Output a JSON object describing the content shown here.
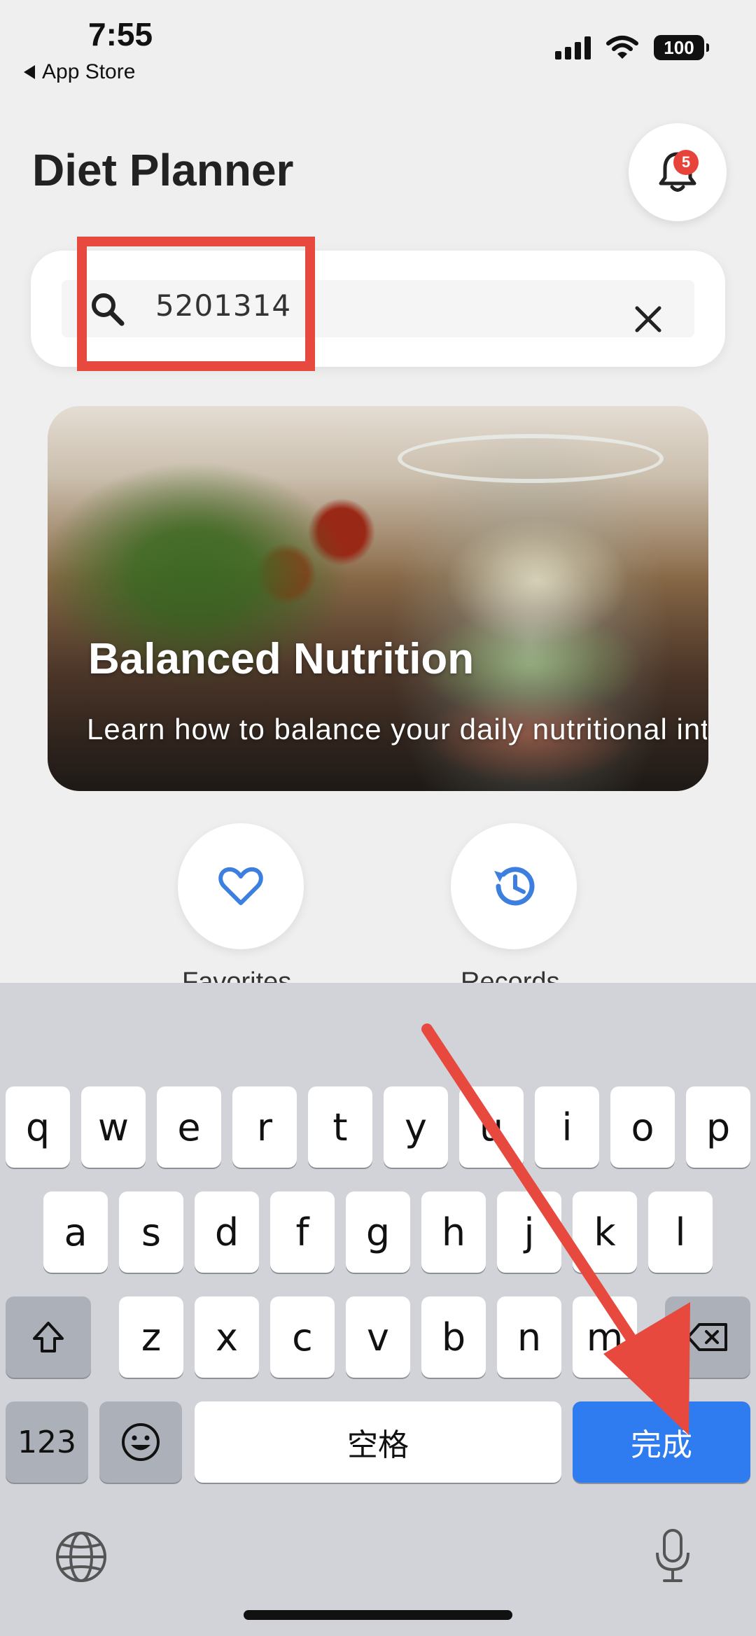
{
  "status_bar": {
    "time": "7:55",
    "back_app": "App Store",
    "battery": "100"
  },
  "header": {
    "title": "Diet Planner",
    "notification_count": "5"
  },
  "search": {
    "value": "5201314",
    "placeholder": ""
  },
  "banner": {
    "title": "Balanced Nutrition",
    "subtitle": "Learn how to balance your daily nutritional intake"
  },
  "quick_actions": [
    {
      "label": "Favorites",
      "icon": "heart-icon"
    },
    {
      "label": "Records",
      "icon": "history-icon"
    }
  ],
  "keyboard": {
    "row1": [
      "q",
      "w",
      "e",
      "r",
      "t",
      "y",
      "u",
      "i",
      "o",
      "p"
    ],
    "row2": [
      "a",
      "s",
      "d",
      "f",
      "g",
      "h",
      "j",
      "k",
      "l"
    ],
    "row3": [
      "z",
      "x",
      "c",
      "v",
      "b",
      "n",
      "m"
    ],
    "numbers_key": "123",
    "space_key": "空格",
    "done_key": "完成"
  },
  "colors": {
    "accent": "#2f7bf0",
    "annotation": "#e8493f",
    "badge": "#e8433a",
    "icon_blue": "#3d7fe0"
  }
}
